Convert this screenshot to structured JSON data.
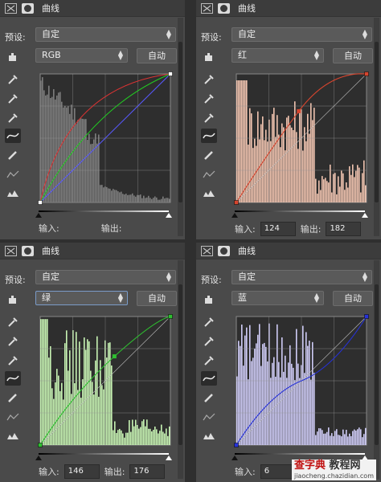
{
  "tab_title": "曲线",
  "preset_label": "预设:",
  "preset_value": "自定",
  "auto_label": "自动",
  "input_label": "输入:",
  "output_label": "输出:",
  "panels": [
    {
      "channel": "RGB",
      "input": "",
      "output": "",
      "hist_color": "#7d7d7d",
      "curve_color": "#ffffff"
    },
    {
      "channel": "红",
      "input": "124",
      "output": "182",
      "hist_color": "#f1c4b0",
      "curve_color": "#d6452e"
    },
    {
      "channel": "绿",
      "input": "146",
      "output": "176",
      "hist_color": "#c8f4b4",
      "curve_color": "#2ec030"
    },
    {
      "channel": "蓝",
      "input": "6",
      "output": "",
      "hist_color": "#cfccf6",
      "curve_color": "#2632d8"
    }
  ],
  "watermark": {
    "line1": "查字典",
    "line2": "教程网",
    "url": "jiaocheng.chazidian.com"
  }
}
